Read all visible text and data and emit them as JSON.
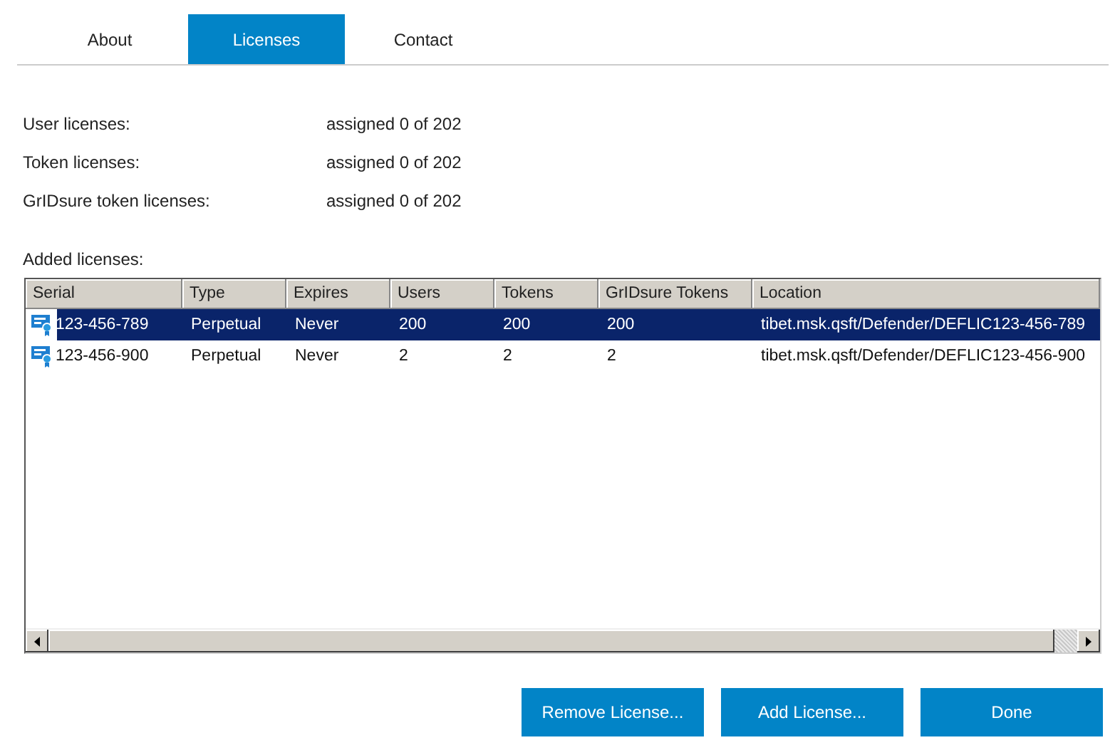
{
  "tabs": [
    {
      "label": "About",
      "selected": false
    },
    {
      "label": "Licenses",
      "selected": true
    },
    {
      "label": "Contact",
      "selected": false
    }
  ],
  "summary": [
    {
      "label": "User licenses:",
      "value": "assigned 0 of 202"
    },
    {
      "label": "Token licenses:",
      "value": "assigned 0 of 202"
    },
    {
      "label": "GrIDsure token licenses:",
      "value": "assigned 0 of 202"
    }
  ],
  "table": {
    "title": "Added licenses:",
    "columns": [
      "Serial",
      "Type",
      "Expires",
      "Users",
      "Tokens",
      "GrIDsure Tokens",
      "Location"
    ],
    "rows": [
      {
        "selected": true,
        "cells": [
          "123-456-789",
          "Perpetual",
          "Never",
          "200",
          "200",
          "200",
          "tibet.msk.qsft/Defender/DEFLIC123-456-789"
        ]
      },
      {
        "selected": false,
        "cells": [
          "123-456-900",
          "Perpetual",
          "Never",
          "2",
          "2",
          "2",
          "tibet.msk.qsft/Defender/DEFLIC123-456-900"
        ]
      }
    ]
  },
  "buttons": [
    "Remove License...",
    "Add License...",
    "Done"
  ]
}
